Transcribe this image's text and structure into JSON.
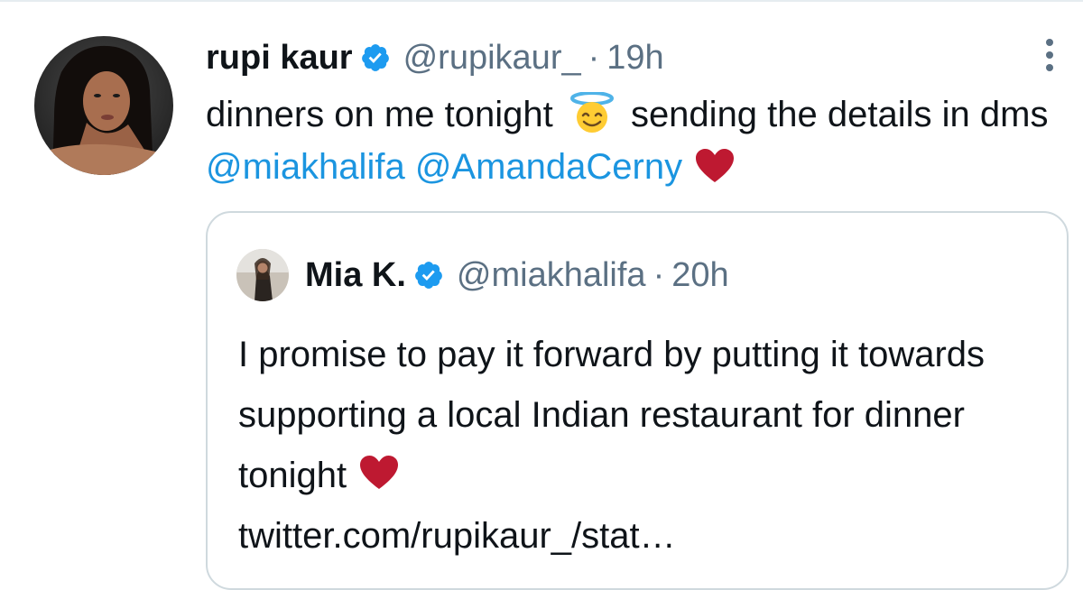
{
  "tweet": {
    "author_name": "rupi kaur",
    "handle": "@rupikaur_",
    "separator": "·",
    "time": "19h",
    "text_part1": "dinners on me tonight",
    "text_part2": "sending the details in dms",
    "mention1": "@miakhalifa",
    "mention2": "@AmandaCerny",
    "emoji_icon": "smiling-face-with-halo-icon",
    "heart_icon": "red-heart-icon"
  },
  "quoted_tweet": {
    "author_name": "Mia K.",
    "handle": "@miakhalifa",
    "separator": "·",
    "time": "20h",
    "text_line": "I promise to pay it forward by putting it towards supporting a local Indian restaurant for dinner tonight",
    "link": "twitter.com/rupikaur_/stat…",
    "heart_icon": "red-heart-icon"
  },
  "colors": {
    "link": "#1b95e0",
    "verified": "#1d9bf0",
    "muted": "#5b7083",
    "heart": "#be1931",
    "card_border": "#cfd9de"
  }
}
